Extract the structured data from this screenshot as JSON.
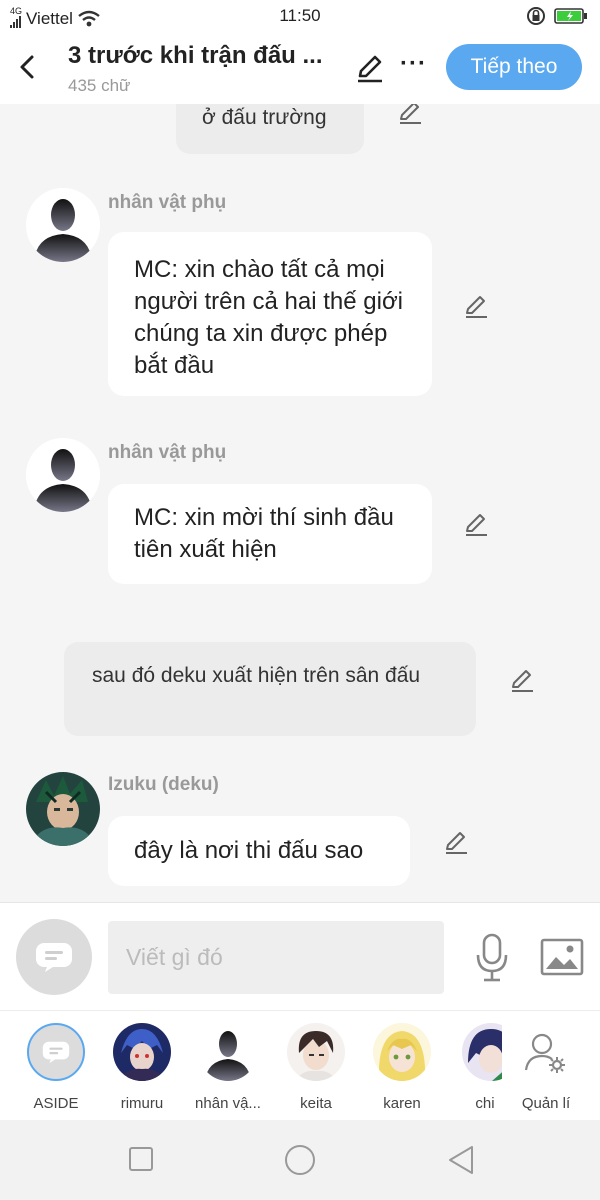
{
  "status_bar": {
    "network": "4G",
    "carrier": "Viettel",
    "time": "11:50"
  },
  "header": {
    "title": "3 trước khi trận đấu ...",
    "word_count": "435 chữ",
    "next_label": "Tiếp theo"
  },
  "messages": {
    "aside_top": "ở đấu trường",
    "msg1_name": "nhân vật phụ",
    "msg1_text": "MC: xin chào tất cả mọi người trên cả hai thế giới  chúng ta xin được phép bắt đầu",
    "msg2_name": "nhân vật phụ",
    "msg2_text": "MC: xin mời thí sinh đầu tiên xuất hiện",
    "aside_mid": "sau đó deku xuất hiện trên sân đấu",
    "msg3_name": "Izuku (deku)",
    "msg3_text": "đây là nơi thi đấu sao"
  },
  "composer": {
    "placeholder": "Viết gì đó"
  },
  "characters": [
    {
      "label": "ASIDE"
    },
    {
      "label": "rimuru"
    },
    {
      "label": "nhân vậ..."
    },
    {
      "label": "keita"
    },
    {
      "label": "karen"
    },
    {
      "label": "chi"
    },
    {
      "label": "Quản lí"
    }
  ],
  "colors": {
    "accent": "#5aa8ef",
    "bubble": "#ffffff",
    "aside_bubble": "#ececec",
    "background": "#f5f5f5"
  },
  "icons": [
    "back-icon",
    "pencil-icon",
    "more-icon",
    "mic-icon",
    "image-icon",
    "aside-icon",
    "manage-icon",
    "square-nav-icon",
    "circle-nav-icon",
    "triangle-nav-icon"
  ]
}
